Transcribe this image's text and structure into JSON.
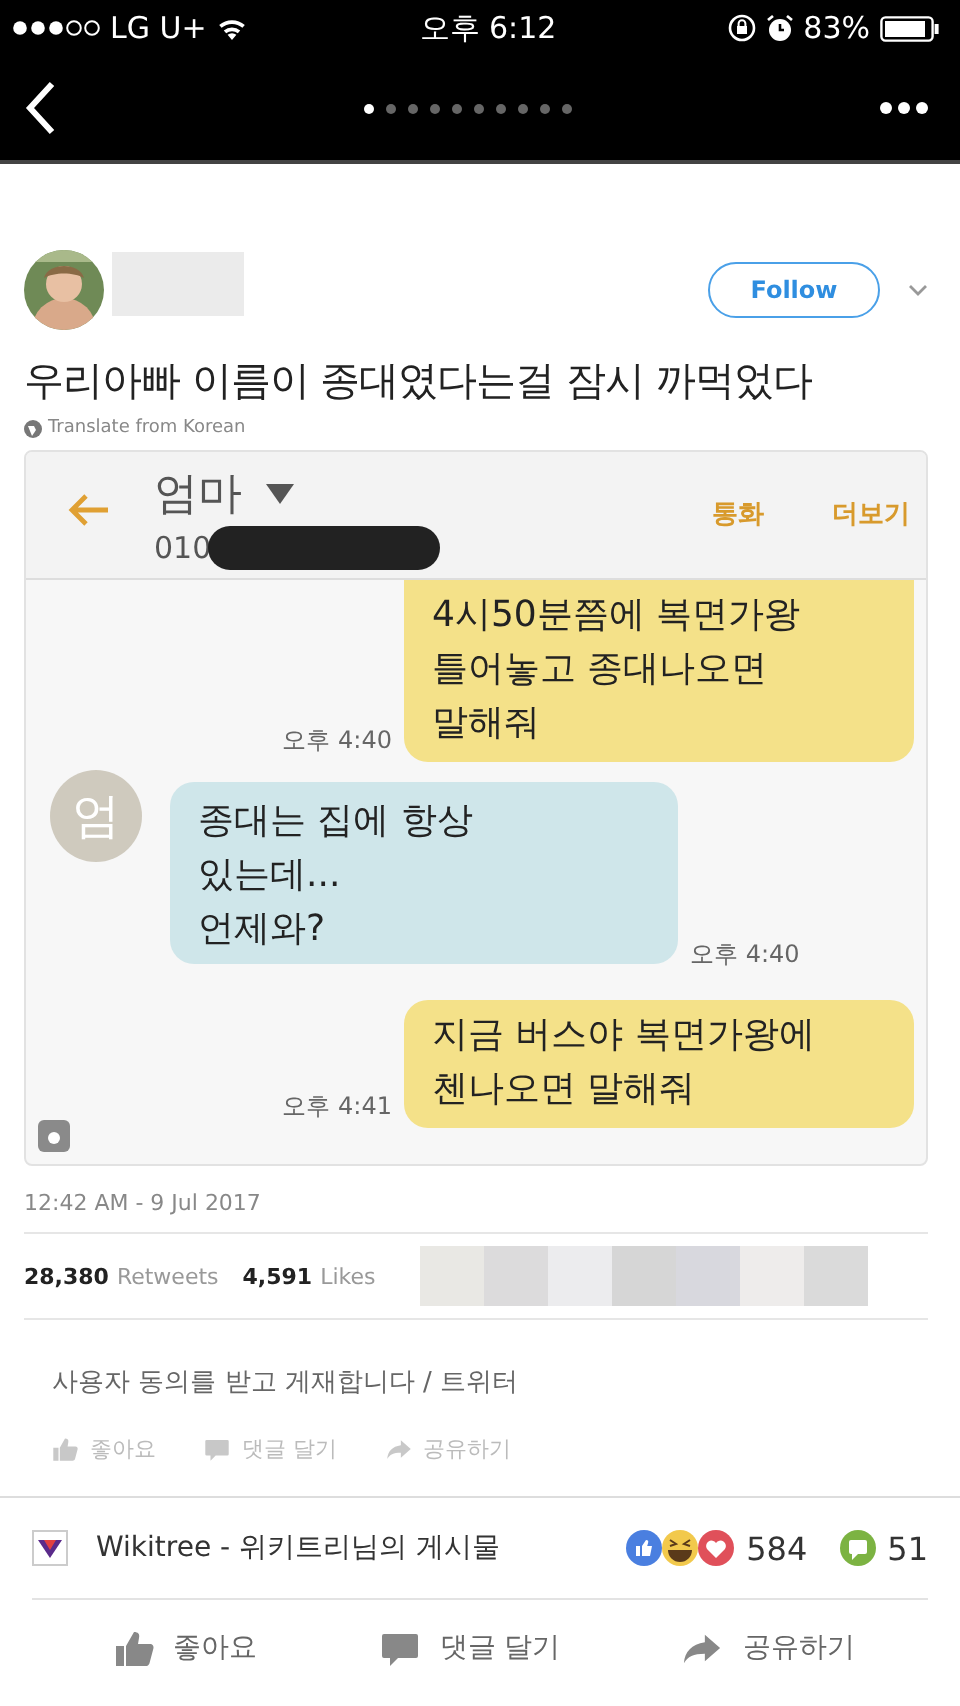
{
  "status_bar": {
    "carrier": "LG U+",
    "time": "오후 6:12",
    "battery": "83%"
  },
  "pager": [
    {
      "selected": true
    },
    {
      "selected": false
    },
    {
      "selected": false
    },
    {
      "selected": false
    },
    {
      "selected": false
    },
    {
      "selected": false
    },
    {
      "selected": false
    },
    {
      "selected": false
    },
    {
      "selected": false
    },
    {
      "selected": false
    }
  ],
  "tweet": {
    "follow": "Follow",
    "text": "우리아빠 이름이 종대였다는걸 잠시 까먹었다",
    "translate": "Translate from Korean",
    "chat": {
      "contact": "엄마",
      "number": "010",
      "actions": [
        "통화",
        "더보기"
      ],
      "avatar_letter": "엄",
      "messages": [
        {
          "kind": "sent",
          "text": "4시50분쯤에 복면가왕\n틀어놓고 종대나오면\n말해줘",
          "time": "오후 4:40"
        },
        {
          "kind": "received",
          "text": "종대는 집에 항상\n있는데...\n언제와?",
          "time": "오후 4:40"
        },
        {
          "kind": "sent",
          "text": "지금 버스야 복면가왕에\n첸나오면 말해줘",
          "time": "오후 4:41"
        }
      ]
    },
    "timestamp": "12:42 AM - 9 Jul 2017",
    "retweets": {
      "count": "28,380",
      "label": "Retweets"
    },
    "likes": {
      "count": "4,591",
      "label": "Likes"
    }
  },
  "caption": "사용자 동의를 받고 게재합니다 / 트위터",
  "inner_actions": [
    {
      "kind": "like",
      "label": "좋아요"
    },
    {
      "kind": "comment",
      "label": "댓글 달기"
    },
    {
      "kind": "share",
      "label": "공유하기"
    }
  ],
  "post": {
    "source": "Wikitree - 위키트리님의 게시물",
    "reactions": "584",
    "comments": "51"
  },
  "actions": [
    {
      "kind": "like",
      "label": "좋아요"
    },
    {
      "kind": "comment",
      "label": "댓글 달기"
    },
    {
      "kind": "share",
      "label": "공유하기"
    }
  ]
}
